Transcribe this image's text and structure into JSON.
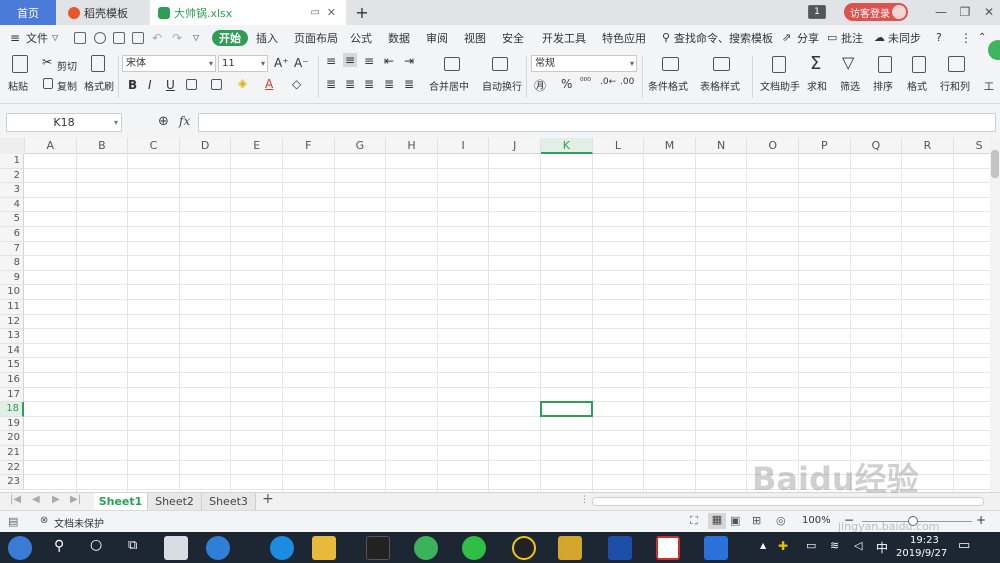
{
  "tabs": {
    "home": "首页",
    "docer": "稻壳模板",
    "file": "大帅锅.xlsx",
    "count": "1",
    "login": "访客登录"
  },
  "menu": {
    "file": "文件",
    "items": [
      "开始",
      "插入",
      "页面布局",
      "公式",
      "数据",
      "审阅",
      "视图",
      "安全",
      "开发工具",
      "特色应用"
    ],
    "search": "查找命令、搜索模板",
    "share": "分享",
    "comment": "批注",
    "sync": "未同步"
  },
  "ribbon": {
    "paste": "粘贴",
    "cut": "剪切",
    "copy": "复制",
    "format_painter": "格式刷",
    "font": "宋体",
    "font_size": "11",
    "bold": "B",
    "italic": "I",
    "underline": "U",
    "merge": "合并居中",
    "wrap": "自动换行",
    "number_format": "常规",
    "cond_format": "条件格式",
    "table_style": "表格样式",
    "doc_helper": "文档助手",
    "sum": "求和",
    "filter": "筛选",
    "sort": "排序",
    "format": "格式",
    "row_col": "行和列",
    "work": "工"
  },
  "formula": {
    "namebox": "K18",
    "fx": "fx"
  },
  "columns": [
    "A",
    "B",
    "C",
    "D",
    "E",
    "F",
    "G",
    "H",
    "I",
    "J",
    "K",
    "L",
    "M",
    "N",
    "O",
    "P",
    "Q",
    "R",
    "S"
  ],
  "selected_col": "K",
  "rows": [
    "1",
    "2",
    "3",
    "4",
    "5",
    "6",
    "7",
    "8",
    "9",
    "10",
    "11",
    "12",
    "13",
    "14",
    "15",
    "16",
    "17",
    "18",
    "19",
    "20",
    "21",
    "22",
    "23"
  ],
  "selected_row": "18",
  "sheets": [
    "Sheet1",
    "Sheet2",
    "Sheet3"
  ],
  "active_sheet": "Sheet1",
  "status": {
    "protect": "文档未保护",
    "zoom": "100%"
  },
  "taskbar": {
    "ime": "中",
    "time": "19:23",
    "date": "2019/9/27"
  },
  "watermark": {
    "main": "Baidu经验",
    "sub": "jingyan.baidu.com"
  },
  "colors": {
    "accent": "#2e9e57",
    "home_tab": "#4a7bd8",
    "login": "#d9534f",
    "taskbar": "#1c2733"
  }
}
